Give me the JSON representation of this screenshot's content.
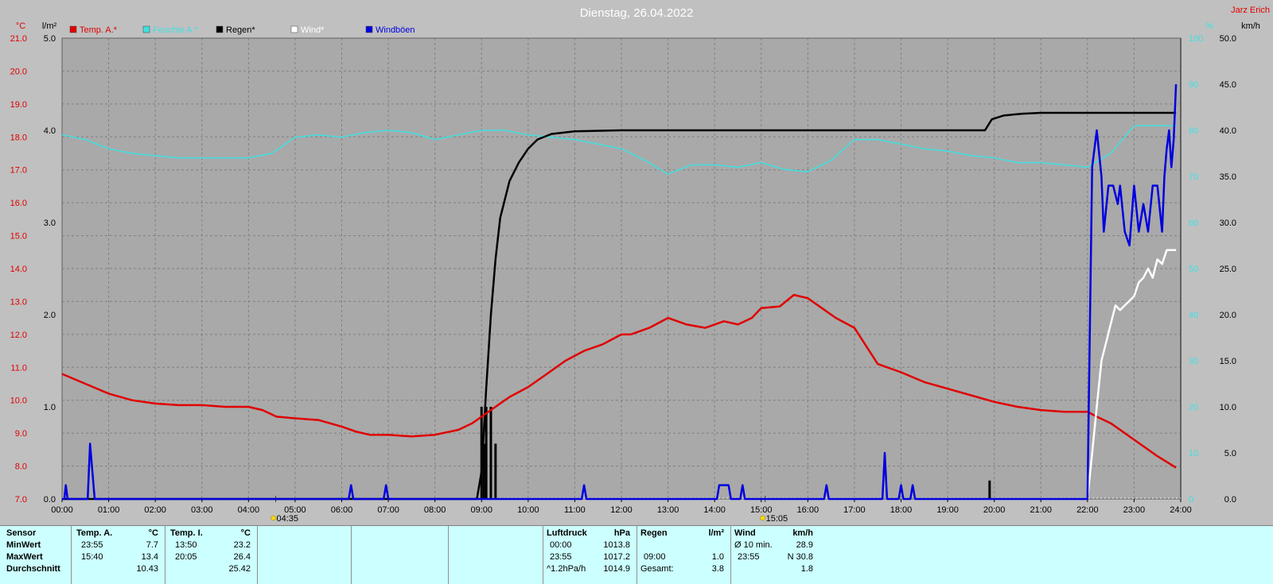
{
  "title": "Dienstag, 26.04.2022",
  "author": "Jarz Erich",
  "units": {
    "temp": "°C",
    "rain": "l/m²",
    "hum": "%",
    "wind": "km/h"
  },
  "colors": {
    "temp": "#e00000",
    "hum": "#40e0e0",
    "rain": "#000000",
    "wind": "#ffffff",
    "gust": "#0000e0",
    "grid": "#808080",
    "bg": "#a9a9a9"
  },
  "chart_data": {
    "type": "line",
    "title": "Dienstag, 26.04.2022",
    "xlim": [
      0,
      24
    ],
    "x_ticks": [
      "00:00",
      "01:00",
      "02:00",
      "03:00",
      "04:00",
      "05:00",
      "06:00",
      "07:00",
      "08:00",
      "09:00",
      "10:00",
      "11:00",
      "12:00",
      "13:00",
      "14:00",
      "15:00",
      "16:00",
      "17:00",
      "18:00",
      "19:00",
      "20:00",
      "21:00",
      "22:00",
      "23:00",
      "24:00"
    ],
    "sun_markers": [
      "04:35",
      "15:05"
    ],
    "axes": {
      "temp": {
        "min": 7,
        "max": 21,
        "ticks": [
          "7.0",
          "8.0",
          "9.0",
          "10.0",
          "11.0",
          "12.0",
          "13.0",
          "14.0",
          "15.0",
          "16.0",
          "17.0",
          "18.0",
          "19.0",
          "20.0",
          "21.0"
        ]
      },
      "rain": {
        "min": 0,
        "max": 5,
        "ticks": [
          "0.0",
          "1.0",
          "2.0",
          "3.0",
          "4.0",
          "5.0"
        ]
      },
      "hum": {
        "min": 0,
        "max": 100,
        "ticks": [
          "0",
          "10",
          "20",
          "30",
          "40",
          "50",
          "60",
          "70",
          "80",
          "90",
          "100"
        ]
      },
      "wind": {
        "min": 0,
        "max": 50,
        "ticks": [
          "0.0",
          "5.0",
          "10.0",
          "15.0",
          "20.0",
          "25.0",
          "30.0",
          "35.0",
          "40.0",
          "45.0",
          "50.0"
        ]
      }
    },
    "legend": [
      {
        "name": "Temp. A.*",
        "color": "#e00000"
      },
      {
        "name": "Feuchte A.*",
        "color": "#40e0e0"
      },
      {
        "name": "Regen*",
        "color": "#000000"
      },
      {
        "name": "Wind*",
        "color": "#ffffff"
      },
      {
        "name": "Windböen",
        "color": "#0000e0"
      }
    ],
    "series": [
      {
        "name": "Temp. A.*",
        "axis": "temp",
        "color": "#e00000",
        "x": [
          0,
          0.5,
          1,
          1.5,
          2,
          2.5,
          3,
          3.5,
          4,
          4.3,
          4.6,
          5,
          5.5,
          6,
          6.3,
          6.6,
          7,
          7.5,
          8,
          8.5,
          8.8,
          9,
          9.3,
          9.6,
          10,
          10.4,
          10.8,
          11.2,
          11.6,
          12,
          12.2,
          12.6,
          13,
          13.4,
          13.8,
          14.2,
          14.5,
          14.8,
          15,
          15.4,
          15.7,
          16,
          16.3,
          16.6,
          17,
          17.5,
          18,
          18.5,
          19,
          19.5,
          20,
          20.5,
          21,
          21.5,
          22,
          22.2,
          22.5,
          23,
          23.5,
          23.9
        ],
        "values": [
          10.8,
          10.5,
          10.2,
          10.0,
          9.9,
          9.85,
          9.85,
          9.8,
          9.8,
          9.7,
          9.5,
          9.45,
          9.4,
          9.2,
          9.05,
          8.95,
          8.95,
          8.9,
          8.95,
          9.1,
          9.3,
          9.5,
          9.8,
          10.1,
          10.4,
          10.8,
          11.2,
          11.5,
          11.7,
          12.0,
          12.0,
          12.2,
          12.5,
          12.3,
          12.2,
          12.4,
          12.3,
          12.5,
          12.8,
          12.85,
          13.2,
          13.1,
          12.8,
          12.5,
          12.2,
          11.1,
          10.85,
          10.55,
          10.35,
          10.15,
          9.95,
          9.8,
          9.7,
          9.65,
          9.65,
          9.5,
          9.3,
          8.8,
          8.3,
          7.95
        ]
      },
      {
        "name": "Feuchte A.*",
        "axis": "hum",
        "color": "#40e0e0",
        "x": [
          0,
          0.5,
          1,
          1.5,
          2,
          2.5,
          3,
          3.5,
          4,
          4.5,
          5,
          5.5,
          6,
          6.5,
          7,
          7.5,
          8,
          8.5,
          9,
          9.5,
          10,
          10.5,
          11,
          11.5,
          12,
          12.5,
          13,
          13.5,
          14,
          14.5,
          15,
          15.5,
          16,
          16.5,
          17,
          17.5,
          18,
          18.5,
          19,
          19.5,
          20,
          20.5,
          21,
          21.5,
          22,
          22.5,
          23,
          23.5,
          23.9
        ],
        "values": [
          79,
          78,
          76,
          75,
          74.5,
          74,
          74,
          74,
          74,
          75,
          78.5,
          79,
          78.5,
          79.5,
          80,
          79.5,
          78,
          79,
          80,
          80,
          79,
          78.5,
          78,
          77,
          76,
          73.5,
          70.5,
          72.5,
          72.5,
          72,
          73,
          71.5,
          71,
          73.5,
          78,
          78,
          77,
          76,
          75.5,
          74.5,
          74,
          73,
          73,
          72.5,
          72,
          75,
          81,
          81,
          81
        ]
      },
      {
        "name": "Regen*",
        "axis": "rain",
        "color": "#000000",
        "x": [
          0,
          8.9,
          9.0,
          9.1,
          9.2,
          9.3,
          9.4,
          9.6,
          9.8,
          10,
          10.2,
          10.5,
          11,
          12,
          13,
          14,
          15,
          16,
          17,
          18,
          19,
          19.8,
          19.95,
          20.2,
          20.6,
          21,
          22,
          23,
          23.9
        ],
        "values": [
          0,
          0,
          0.3,
          1.2,
          2.0,
          2.6,
          3.05,
          3.45,
          3.65,
          3.8,
          3.9,
          3.96,
          3.99,
          4.0,
          4.0,
          4.0,
          4.0,
          4.0,
          4.0,
          4.0,
          4.0,
          4.0,
          4.12,
          4.16,
          4.18,
          4.19,
          4.19,
          4.19,
          4.19
        ]
      },
      {
        "name": "Wind*",
        "axis": "wind",
        "color": "#ffffff",
        "x": [
          22.0,
          22.1,
          22.2,
          22.3,
          22.4,
          22.5,
          22.6,
          22.7,
          22.8,
          22.9,
          23.0,
          23.1,
          23.2,
          23.3,
          23.4,
          23.5,
          23.6,
          23.7,
          23.8,
          23.9
        ],
        "values": [
          0,
          5,
          10,
          15,
          17,
          19,
          21,
          20.5,
          21,
          21.5,
          22,
          23.5,
          24,
          25,
          24,
          26,
          25.5,
          27,
          27,
          27
        ]
      },
      {
        "name": "Windböen",
        "axis": "wind",
        "color": "#0000e0",
        "x": [
          0,
          0.05,
          0.08,
          0.12,
          0.2,
          0.55,
          0.6,
          0.65,
          0.7,
          6.15,
          6.2,
          6.25,
          6.9,
          6.95,
          7.0,
          11.15,
          11.2,
          11.25,
          14.05,
          14.1,
          14.3,
          14.35,
          14.55,
          14.6,
          14.65,
          16.35,
          16.4,
          16.45,
          17.6,
          17.65,
          17.7,
          17.95,
          18.0,
          18.05,
          18.2,
          18.25,
          18.3,
          21.9,
          22.0,
          22.1,
          22.2,
          22.3,
          22.35,
          22.45,
          22.55,
          22.65,
          22.7,
          22.8,
          22.9,
          23.0,
          23.1,
          23.2,
          23.3,
          23.4,
          23.5,
          23.6,
          23.65,
          23.7,
          23.75,
          23.8,
          23.85,
          23.9
        ],
        "values": [
          0,
          0,
          1.5,
          0,
          0,
          0,
          6,
          3,
          0,
          0,
          1.5,
          0,
          0,
          1.5,
          0,
          0,
          1.5,
          0,
          0,
          1.5,
          1.5,
          0,
          0,
          1.5,
          0,
          0,
          1.5,
          0,
          0,
          5,
          0,
          0,
          1.5,
          0,
          0,
          1.5,
          0,
          0,
          0,
          36,
          40,
          35,
          29,
          34,
          34,
          32,
          34,
          29,
          27.5,
          34,
          29,
          32,
          29,
          34,
          34,
          29,
          35,
          38,
          40,
          36,
          39,
          45
        ]
      }
    ],
    "rain_bars": [
      {
        "x": 9.0,
        "value": 1.0
      },
      {
        "x": 9.05,
        "value": 0.6
      },
      {
        "x": 9.1,
        "value": 1.0
      },
      {
        "x": 9.2,
        "value": 1.0
      },
      {
        "x": 9.3,
        "value": 0.6
      },
      {
        "x": 19.9,
        "value": 0.2
      }
    ]
  },
  "stats": {
    "sensor": {
      "header": "Sensor",
      "rows": [
        "MinWert",
        "MaxWert",
        "Durchschnitt"
      ]
    },
    "temp_a": {
      "header": "Temp. A.",
      "unit": "°C",
      "min_time": "23:55",
      "min": "7.7",
      "max_time": "15:40",
      "max": "13.4",
      "avg": "10.43"
    },
    "temp_i": {
      "header": "Temp. I.",
      "unit": "°C",
      "min_time": "13:50",
      "min": "23.2",
      "max_time": "20:05",
      "max": "26.4",
      "avg": "25.42"
    },
    "pressure": {
      "header": "Luftdruck",
      "unit": "hPa",
      "min_time": "00:00",
      "min": "1013.8",
      "max_time": "23:55",
      "max": "1017.2",
      "avg_label": "^1.2hPa/h",
      "avg": "1014.9"
    },
    "rain": {
      "header": "Regen",
      "unit": "l/m²",
      "max_time": "09:00",
      "max": "1.0",
      "total_label": "Gesamt:",
      "total": "3.8"
    },
    "wind": {
      "header": "Wind",
      "unit": "km/h",
      "avg_label": "Ø 10 min.",
      "avg": "28.9",
      "max_time": "23:55",
      "max": "N 30.8",
      "mean": "1.8"
    }
  }
}
